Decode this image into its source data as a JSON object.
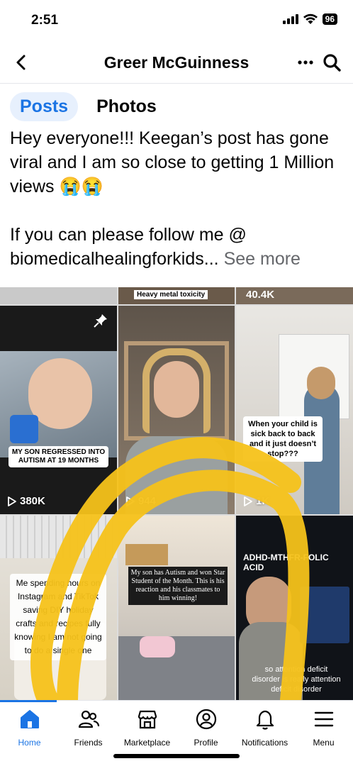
{
  "status_bar": {
    "time": "2:51",
    "battery": "96"
  },
  "header": {
    "title": "Greer McGuinness"
  },
  "tabs": [
    {
      "label": "Posts",
      "active": true
    },
    {
      "label": "Photos",
      "active": false
    }
  ],
  "post": {
    "paragraph1": "Hey everyone!!! Keegan’s post has gone viral and I am so close to getting 1 Million views 😭😭",
    "paragraph2": "If you can please follow me @ biomedicalhealingforkids...",
    "see_more": "See more"
  },
  "top_strip": [
    {
      "text": "Heavy metal toxicity"
    },
    {
      "text": "40.4K"
    }
  ],
  "videos": [
    {
      "caption": "MY SON REGRESSED INTO AUTISM AT 19 MONTHS",
      "views": "380K",
      "pinned": true
    },
    {
      "caption": "",
      "views": "944",
      "pinned": false
    },
    {
      "caption": "When your child is sick back to back and it just doesn’t stop???",
      "views": "1K",
      "pinned": false
    },
    {
      "caption": "Me spending hours on Instagram and TikTok saving DIY holiday crafts and recipes fully knowing I am not going to do a single one",
      "views": "",
      "pinned": false
    },
    {
      "caption": "My son has Autism and won Star Student of the Month. This is his reaction and his classmates to him winning!",
      "views": "",
      "pinned": false
    },
    {
      "caption_top": "ADHD-MTHFR-FOLIC ACID",
      "caption": "so attention deficit disorder is really attention deficit disorder",
      "views": "",
      "pinned": false
    }
  ],
  "bottom_nav": [
    {
      "label": "Home",
      "icon": "home-icon",
      "active": true
    },
    {
      "label": "Friends",
      "icon": "friends-icon",
      "active": false
    },
    {
      "label": "Marketplace",
      "icon": "marketplace-icon",
      "active": false
    },
    {
      "label": "Profile",
      "icon": "profile-icon",
      "active": false
    },
    {
      "label": "Notifications",
      "icon": "bell-icon",
      "active": false
    },
    {
      "label": "Menu",
      "icon": "menu-icon",
      "active": false
    }
  ],
  "colors": {
    "accent": "#1b74e4",
    "annotation": "#f5c21a"
  }
}
